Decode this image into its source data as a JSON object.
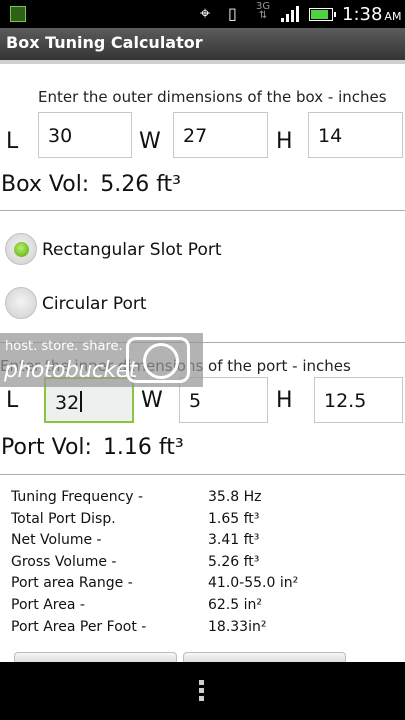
{
  "status_bar": {
    "network": "3G",
    "time": "1:38",
    "ampm": "AM",
    "battery_level": 0.85
  },
  "app": {
    "title": "Box Tuning Calculator"
  },
  "box": {
    "prompt": "Enter the outer dimensions of the box - inches",
    "l_label": "L",
    "w_label": "W",
    "h_label": "H",
    "length": "30",
    "width": "27",
    "height": "14",
    "volume_label": "Box Vol:",
    "volume_value": "5.26 ft³"
  },
  "port_type": {
    "options": [
      {
        "label": "Rectangular Slot Port",
        "selected": true
      },
      {
        "label": "Circular Port",
        "selected": false
      }
    ]
  },
  "port": {
    "prompt": "Enter the inner dimensions of the port - inches",
    "l_label": "L",
    "w_label": "W",
    "h_label": "H",
    "length": "32",
    "width": "5",
    "height": "12.5",
    "volume_label": "Port Vol:",
    "volume_value": "1.16 ft³"
  },
  "watermark": {
    "tagline": "host. store. share.",
    "brand": "photobucket"
  },
  "results": [
    {
      "label": "Tuning Frequency -",
      "value": "35.8 Hz"
    },
    {
      "label": "Total Port Disp.",
      "value": "1.65 ft³"
    },
    {
      "label": "Net Volume -",
      "value": "3.41 ft³"
    },
    {
      "label": "Gross Volume -",
      "value": "5.26 ft³"
    },
    {
      "label": "Port area Range -",
      "value": "41.0-55.0 in²"
    },
    {
      "label": "Port Area -",
      "value": "62.5 in²"
    },
    {
      "label": "Port Area Per Foot -",
      "value": "18.33in²"
    }
  ],
  "icons": {
    "status": [
      "notification-icon",
      "gps-icon",
      "vibrate-icon",
      "network-3g-icon",
      "signal-icon",
      "battery-icon"
    ],
    "nav": [
      "menu-icon"
    ]
  },
  "colors": {
    "title_bar": "#3c3c3c",
    "accent_green": "#7ac943",
    "battery_green": "#4ed142"
  }
}
